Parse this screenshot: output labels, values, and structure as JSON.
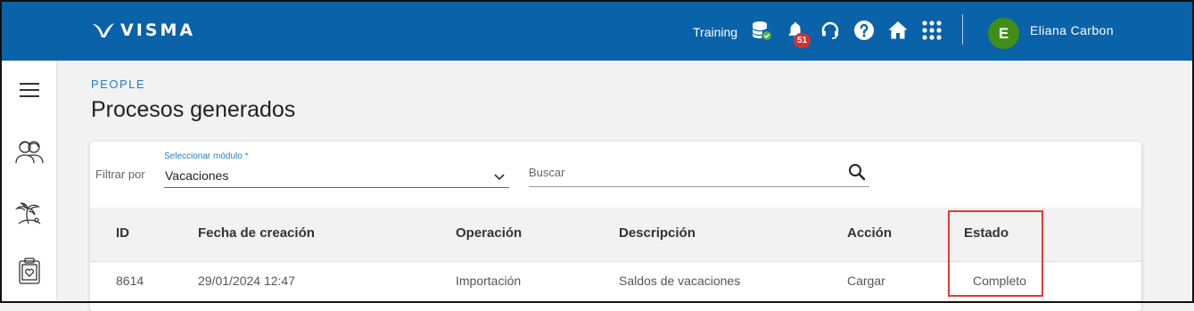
{
  "header": {
    "logo_text": "VISMA",
    "environment": "Training",
    "notification_count": "51",
    "user": {
      "initial": "E",
      "name": "Eliana Carbon"
    },
    "icons": [
      "database-check-icon",
      "bell-icon",
      "headset-icon",
      "help-icon",
      "home-icon",
      "apps-grid-icon"
    ]
  },
  "sidenav": {
    "items": [
      "menu-icon",
      "people-icon",
      "vacation-icon",
      "health-clipboard-icon"
    ]
  },
  "page": {
    "breadcrumb": "PEOPLE",
    "title": "Procesos generados"
  },
  "filter": {
    "label": "Filtrar por",
    "module_label": "Seleccionar módulo *",
    "module_value": "Vacaciones",
    "search_placeholder": "Buscar"
  },
  "table": {
    "columns": [
      "ID",
      "Fecha de creación",
      "Operación",
      "Descripción",
      "Acción",
      "Estado"
    ],
    "rows": [
      [
        "8614",
        "29/01/2024 12:47",
        "Importación",
        "Saldos de vacaciones",
        "Cargar",
        "Completo"
      ]
    ]
  },
  "colors": {
    "brand": "#0a62a9",
    "accent": "#1f7fc4",
    "badge": "#d32f2f",
    "avatar": "#3f8f16",
    "highlight": "#e53935"
  }
}
